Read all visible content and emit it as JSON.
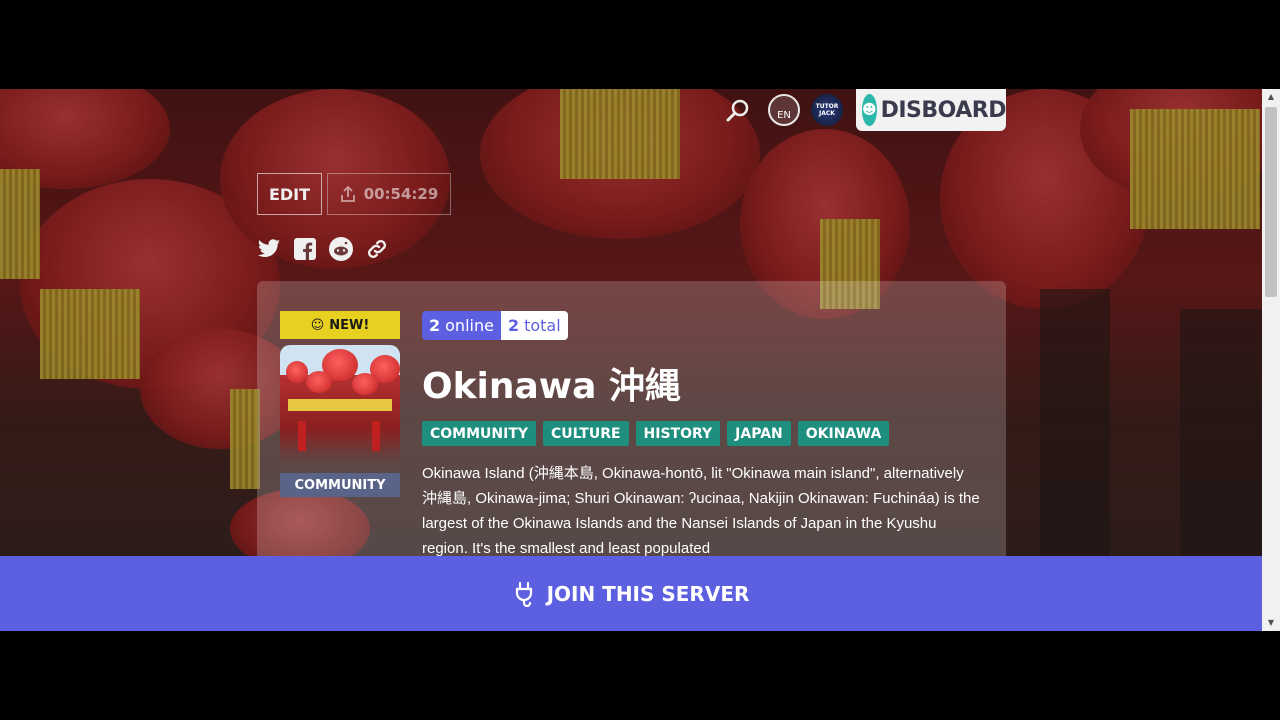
{
  "nav": {
    "lang_label": "EN",
    "avatar_label": "TUTOR JACK",
    "brand_name": "DISBOARD"
  },
  "actions": {
    "edit_label": "EDIT",
    "bump_timer": "00:54:29"
  },
  "share": [
    "twitter-icon",
    "facebook-icon",
    "reddit-icon",
    "link-icon"
  ],
  "server": {
    "new_badge": "NEW!",
    "category": "COMMUNITY",
    "online_count": "2",
    "online_label": "online",
    "total_count": "2",
    "total_label": "total",
    "name": "Okinawa 沖縄",
    "tags": [
      "COMMUNITY",
      "CULTURE",
      "HISTORY",
      "JAPAN",
      "OKINAWA"
    ],
    "description": "Okinawa Island (沖縄本島, Okinawa-hontō, lit \"Okinawa main island\", alternatively 沖縄島, Okinawa-jima; Shuri Okinawan: ʔucinaa, Nakijin Okinawan: Fuchináa) is the largest of the Okinawa Islands and the Nansei Islands of Japan in the Kyushu region. It's the smallest and least populated"
  },
  "join": {
    "label": "JOIN THIS SERVER"
  },
  "colors": {
    "accent": "#5b5fe0",
    "tag": "#1e8e7e",
    "new_badge": "#e8d020",
    "category": "#5a6488"
  }
}
